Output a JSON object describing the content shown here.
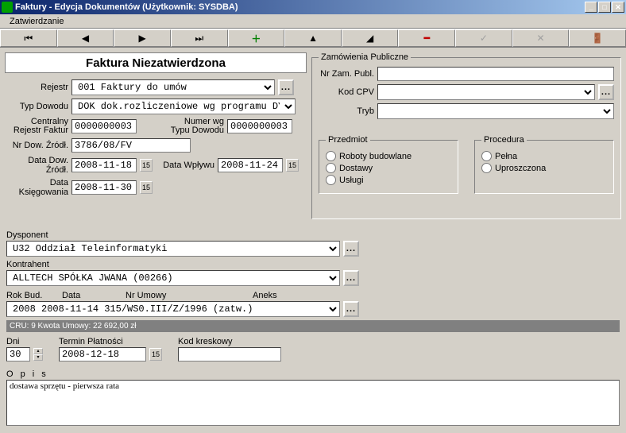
{
  "window": {
    "title": "Faktury - Edycja Dokumentów (Użytkownik: SYSDBA)"
  },
  "menubar": {
    "item1": "Zatwierdzanie"
  },
  "header": {
    "title": "Faktura Niezatwierdzona"
  },
  "labels": {
    "rejestr": "Rejestr",
    "typ_dowodu": "Typ Dowodu",
    "centralny_rejestr": "Centralny\nRejestr Faktur",
    "centralny1": "Centralny",
    "centralny2": "Rejestr Faktur",
    "numer_wg1": "Numer wg",
    "numer_wg2": "Typu Dowodu",
    "nr_dow_zrodl": "Nr Dow. Źródł.",
    "data_dow_zrodl": "Data Dow. Źródł.",
    "data_wplywu": "Data Wpływu",
    "data_ksiegowania": "Data Księgowania",
    "dysponent": "Dysponent",
    "kontrahent": "Kontrahent",
    "rok_bud": "Rok Bud.",
    "data": "Data",
    "nr_umowy": "Nr Umowy",
    "aneks": "Aneks",
    "dni": "Dni",
    "termin_platnosci": "Termin Płatności",
    "kod_kreskowy": "Kod kreskowy",
    "opis": "O p i s"
  },
  "values": {
    "rejestr": "001  Faktury do umów",
    "typ_dowodu": "DOK dok.rozliczeniowe wg programu DYS",
    "centralny_rejestr": "0000000003",
    "numer_wg": "0000000003",
    "nr_dow_zrodl": "3786/08/FV",
    "data_dow_zrodl": "2008-11-18",
    "data_wplywu": "2008-11-24",
    "data_ksiegowania": "2008-11-30",
    "dysponent": "U32  Oddział Teleinformatyki",
    "kontrahent": "ALLTECH  SPÓŁKA JWANA (00266)",
    "umowa_combined": "2008  2008-11-14  315/WS0.III/Z/1996        (zatw.)",
    "dni": "30",
    "termin_platnosci": "2008-12-18",
    "kod_kreskowy": "",
    "opis": "dostawa sprzętu - pierwsza rata"
  },
  "status": "CRU: 9   Kwota Umowy: 22 692,00 zł",
  "right": {
    "legend_zamowienia": "Zamówienia Publiczne",
    "nr_zam": "Nr Zam. Publ.",
    "kod_cpv": "Kod CPV",
    "tryb": "Tryb",
    "przedmiot": {
      "legend": "Przedmiot",
      "opt1": "Roboty budowlane",
      "opt2": "Dostawy",
      "opt3": "Usługi"
    },
    "procedura": {
      "legend": "Procedura",
      "opt1": "Pełna",
      "opt2": "Uproszczona"
    }
  }
}
